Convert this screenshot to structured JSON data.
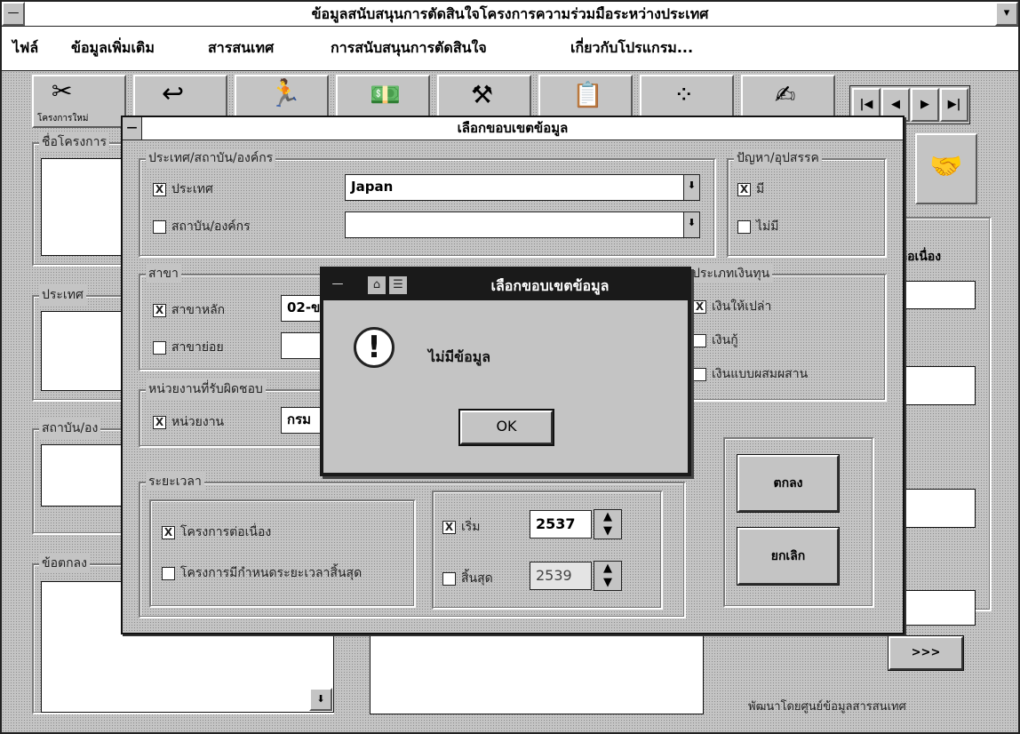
{
  "main_window": {
    "title": "ข้อมูลสนับสนุนการตัดสินใจโครงการความร่วมมือระหว่างประเทศ",
    "sys_glyph": "—",
    "scroll_glyph": "▾"
  },
  "menu": [
    "ไฟล์",
    "ข้อมูลเพิ่มเติม",
    "สารสนเทศ",
    "การสนับสนุนการตัดสินใจ",
    "เกี่ยวกับโปรแกรม..."
  ],
  "toolbar": {
    "nav_buttons": [
      "|◀",
      "◀",
      "▶",
      "▶|"
    ],
    "first_tool_label": "โครงการใหม่"
  },
  "background": {
    "project_name_label": "ชื่อโครงการ",
    "country_label": "ประเทศ",
    "institution_label": "สถาบัน/อง",
    "agreement_label": "ข้อตกลง",
    "related_label": "ต่อเนื่อง",
    "more_button": ">>>",
    "footer": "พัฒนาโดยศูนย์ข้อมูลสารสนเทศ",
    "scroll_down": "⬇"
  },
  "dialog": {
    "title": "เลือกขอบเขตข้อมูล",
    "group_country": {
      "label": "ประเทศ/สถาบัน/องค์กร",
      "country_check": "ประเทศ",
      "country_checked": true,
      "country_value": "Japan",
      "institution_check": "สถาบัน/องค์กร",
      "institution_checked": false,
      "institution_value": ""
    },
    "group_problem": {
      "label": "ปัญหา/อุปสรรค",
      "has": "มี",
      "has_checked": true,
      "none": "ไม่มี",
      "none_checked": false
    },
    "group_branch": {
      "label": "สาขา",
      "main_check": "สาขาหลัก",
      "main_checked": true,
      "main_value": "02-ข",
      "sub_check": "สาขาย่อย",
      "sub_checked": false
    },
    "group_funding": {
      "label": "ประเภทเงินทุน",
      "grant": "เงินให้เปล่า",
      "grant_checked": true,
      "loan": "เงินกู้",
      "loan_checked": false,
      "mixed": "เงินแบบผสมผสาน",
      "mixed_checked": false
    },
    "group_agency": {
      "label": "หน่วยงานที่รับผิดชอบ",
      "agency_check": "หน่วยงาน",
      "agency_checked": true,
      "agency_value": "กรม"
    },
    "group_period": {
      "label": "ระยะเวลา",
      "continuing": "โครงการต่อเนื่อง",
      "continuing_checked": true,
      "no_end": "โครงการมีกำหนดระยะเวลาสิ้นสุด",
      "no_end_checked": false,
      "start_label": "เริ่ม",
      "start_checked": true,
      "start_value": "2537",
      "end_label": "สิ้นสุด",
      "end_checked": false,
      "end_value": "2539"
    },
    "ok_button": "ตกลง",
    "cancel_button": "ยกเลิก"
  },
  "alert": {
    "title": "เลือกขอบเขตข้อมูล",
    "message": "ไม่มีข้อมูล",
    "ok": "OK",
    "icon_glyph": "!"
  }
}
